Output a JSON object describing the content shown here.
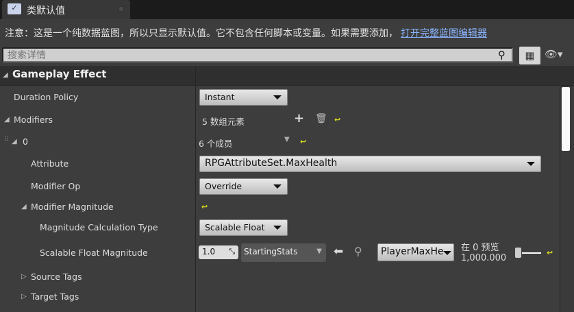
{
  "tab": {
    "title": "类默认值",
    "icon": "blueprint-class-icon"
  },
  "notice": {
    "text": "注意：这是一个纯数据蓝图，所以只显示默认值。它不包含任何脚本或变量。如果需要添加，",
    "link": "打开完整蓝图编辑器"
  },
  "search": {
    "placeholder": "搜索详情",
    "value": ""
  },
  "category": "Gameplay Effect",
  "rows": {
    "duration_policy": {
      "label": "Duration Policy",
      "value": "Instant"
    },
    "modifiers": {
      "label": "Modifiers",
      "value": "5 数组元素"
    },
    "element0": {
      "label": "0",
      "value": "6 个成员"
    },
    "attribute": {
      "label": "Attribute",
      "value": "RPGAttributeSet.MaxHealth"
    },
    "modifier_op": {
      "label": "Modifier Op",
      "value": "Override"
    },
    "modifier_magnitude": {
      "label": "Modifier Magnitude"
    },
    "calc_type": {
      "label": "Magnitude Calculation Type",
      "value": "Scalable Float"
    },
    "scalable_float": {
      "label": "Scalable Float Magnitude",
      "coefficient": "1.0",
      "curve_table": "StartingStats",
      "row_name": "PlayerMaxHe",
      "preview_label": "在 0 预览",
      "preview_value": "1,000.000",
      "preview_slider": 0
    },
    "source_tags": {
      "label": "Source Tags"
    },
    "target_tags": {
      "label": "Target Tags"
    }
  }
}
